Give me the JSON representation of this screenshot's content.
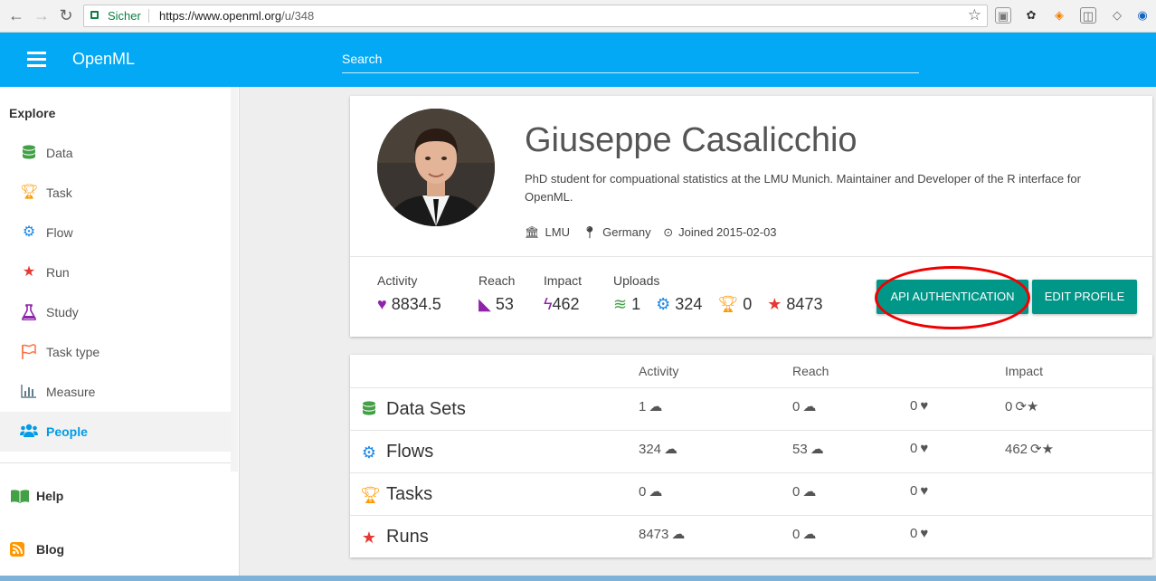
{
  "browser": {
    "secure_label": "Sicher",
    "url_scheme_host": "https://www.openml.org",
    "url_path": "/u/348"
  },
  "appbar": {
    "brand": "OpenML",
    "search_placeholder": "Search"
  },
  "sidebar": {
    "section_title": "Explore",
    "items": [
      {
        "label": "Data",
        "icon": "database-icon",
        "color": "#43a047"
      },
      {
        "label": "Task",
        "icon": "trophy-icon",
        "color": "#ff9800"
      },
      {
        "label": "Flow",
        "icon": "cogs-icon",
        "color": "#1e88e5"
      },
      {
        "label": "Run",
        "icon": "star-icon",
        "color": "#e53935"
      },
      {
        "label": "Study",
        "icon": "flask-icon",
        "color": "#8e24aa"
      },
      {
        "label": "Task type",
        "icon": "flag-icon",
        "color": "#ff7043"
      },
      {
        "label": "Measure",
        "icon": "bar-chart-icon",
        "color": "#607d8b"
      },
      {
        "label": "People",
        "icon": "users-icon",
        "color": "#039be5"
      }
    ],
    "active": "People",
    "links": [
      {
        "label": "Help",
        "icon": "book-icon",
        "color": "#43a047"
      },
      {
        "label": "Blog",
        "icon": "rss-icon",
        "color": "#ff9800"
      }
    ]
  },
  "profile": {
    "name": "Giuseppe Casalicchio",
    "bio": "PhD student for compuational statistics at the LMU Munich. Maintainer and Developer of the R interface for OpenML.",
    "affiliation": "LMU",
    "country": "Germany",
    "joined": "Joined 2015-02-03",
    "stats": {
      "activity_label": "Activity",
      "activity_value": "8834.5",
      "reach_label": "Reach",
      "reach_value": "53",
      "impact_label": "Impact",
      "impact_value": "462",
      "uploads_label": "Uploads",
      "uploads_data": "1",
      "uploads_flows": "324",
      "uploads_tasks": "0",
      "uploads_runs": "8473"
    },
    "buttons": {
      "api": "API AUTHENTICATION",
      "edit": "EDIT PROFILE"
    },
    "accent_color": "#009688"
  },
  "table": {
    "headers": {
      "activity": "Activity",
      "reach": "Reach",
      "impact": "Impact"
    },
    "rows": [
      {
        "name": "Data Sets",
        "icon": "database-icon",
        "color": "#43a047",
        "uploads": "1",
        "reach": "0",
        "likes": "0",
        "impact": "0"
      },
      {
        "name": "Flows",
        "icon": "cogs-icon",
        "color": "#1e88e5",
        "uploads": "324",
        "reach": "53",
        "likes": "0",
        "impact": "462"
      },
      {
        "name": "Tasks",
        "icon": "trophy-icon",
        "color": "#ff9800",
        "uploads": "0",
        "reach": "0",
        "likes": "0",
        "impact": ""
      },
      {
        "name": "Runs",
        "icon": "star-icon",
        "color": "#e53935",
        "uploads": "8473",
        "reach": "0",
        "likes": "0",
        "impact": ""
      }
    ]
  }
}
